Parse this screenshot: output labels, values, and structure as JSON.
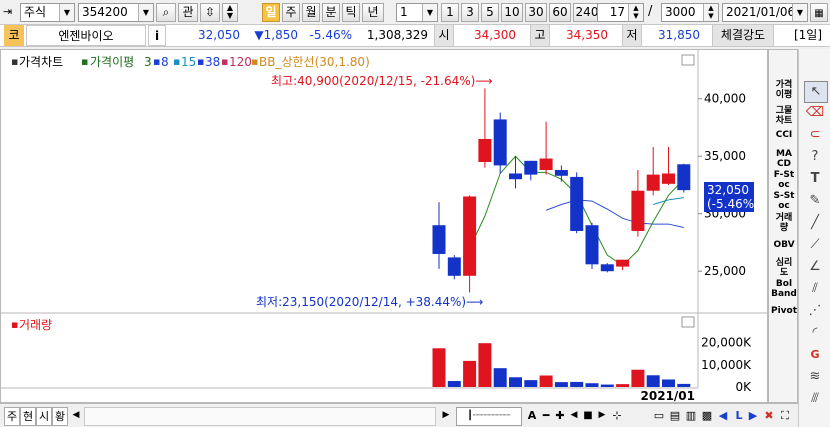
{
  "toolbar": {
    "market_type": "주식",
    "stock_code": "354200",
    "btn_search": "⌕",
    "btn_gwan": "관",
    "period_tabs": [
      "일",
      "주",
      "월",
      "분",
      "틱",
      "년"
    ],
    "active_period": "일",
    "interval_value": "1",
    "interval_presets": [
      "1",
      "3",
      "5",
      "10",
      "30",
      "60",
      "240"
    ],
    "count_value": "17",
    "slash": "/",
    "total_count": "3000",
    "date": "2021/01/06"
  },
  "quote": {
    "market_badge": "코",
    "stock_name": "엔젠바이오",
    "info_btn": "i",
    "price": "32,050",
    "change": "▼1,850",
    "change_pct": "-5.46%",
    "volume": "1,308,329",
    "open_label": "시",
    "open": "34,300",
    "high_label": "고",
    "high": "34,350",
    "low_label": "저",
    "low": "31,850",
    "strength_label": "체결강도",
    "tab_label": "[1일]"
  },
  "legend": {
    "price_chart": "가격차트",
    "ma_label": "가격이평",
    "ma_periods": [
      "3",
      "8",
      "15",
      "38",
      "120"
    ],
    "bb_label": "BB_상한선(30,1.80)",
    "volume_label": "거래량"
  },
  "annotations": {
    "high": "최고:40,900(2020/12/15, -21.64%)⟶",
    "low": "최저:23,150(2020/12/14, +38.44%)⟶"
  },
  "price_badge": {
    "price": "32,050",
    "pct": "(-5.46%)"
  },
  "sidebar_items": [
    "가격이평",
    "그물차트",
    "CCI",
    "MACD",
    "F-Stoc",
    "S-Stoc",
    "거래량",
    "OBV",
    "심리도",
    "Bol Band",
    "Pivot"
  ],
  "bottom": {
    "tabs": [
      "주",
      "현",
      "시",
      "황"
    ],
    "date_label": "2021/01",
    "zoom_a": "A"
  },
  "chart_data": {
    "type": "candlestick",
    "yaxis_price": {
      "ticks": [
        25000,
        30000,
        35000,
        40000
      ],
      "tick_labels": [
        "25,000",
        "30,000",
        "35,000",
        "40,000"
      ],
      "ylim": [
        21800,
        42500
      ]
    },
    "yaxis_volume": {
      "tick_labels": [
        "20,000K",
        "10,000K",
        "0K"
      ],
      "ticks": [
        20000,
        10000,
        0
      ],
      "ylim": [
        0,
        23500
      ]
    },
    "x_label": "2021/01",
    "candles": [
      {
        "open": 29000,
        "close": 26500,
        "high": 31000,
        "low": 25200,
        "dir": "down"
      },
      {
        "open": 26200,
        "close": 24600,
        "high": 26400,
        "low": 24300,
        "dir": "down"
      },
      {
        "open": 24600,
        "close": 31500,
        "high": 31600,
        "low": 23150,
        "dir": "up"
      },
      {
        "open": 34500,
        "close": 36500,
        "high": 40900,
        "low": 34000,
        "dir": "up"
      },
      {
        "open": 38200,
        "close": 34200,
        "high": 38800,
        "low": 33500,
        "dir": "down"
      },
      {
        "open": 33500,
        "close": 33000,
        "high": 35000,
        "low": 32200,
        "dir": "down"
      },
      {
        "open": 34600,
        "close": 33400,
        "high": 34600,
        "low": 32900,
        "dir": "down"
      },
      {
        "open": 33800,
        "close": 34800,
        "high": 38000,
        "low": 33400,
        "dir": "up"
      },
      {
        "open": 33800,
        "close": 33300,
        "high": 34200,
        "low": 32800,
        "dir": "down"
      },
      {
        "open": 33200,
        "close": 28500,
        "high": 33600,
        "low": 28300,
        "dir": "down"
      },
      {
        "open": 29000,
        "close": 25600,
        "high": 29200,
        "low": 25200,
        "dir": "down"
      },
      {
        "open": 25600,
        "close": 25000,
        "high": 25700,
        "low": 24900,
        "dir": "down"
      },
      {
        "open": 25400,
        "close": 26000,
        "high": 26000,
        "low": 25100,
        "dir": "up"
      },
      {
        "open": 28500,
        "close": 32000,
        "high": 33800,
        "low": 28000,
        "dir": "up"
      },
      {
        "open": 32000,
        "close": 33400,
        "high": 35800,
        "low": 31600,
        "dir": "up"
      },
      {
        "open": 32600,
        "close": 33500,
        "high": 35800,
        "low": 32500,
        "dir": "up"
      },
      {
        "open": 34300,
        "close": 32050,
        "high": 34350,
        "low": 31850,
        "dir": "down"
      }
    ],
    "volumes": [
      {
        "value": 17500,
        "dir": "up"
      },
      {
        "value": 2700,
        "dir": "down"
      },
      {
        "value": 11800,
        "dir": "up"
      },
      {
        "value": 19800,
        "dir": "up"
      },
      {
        "value": 8500,
        "dir": "down"
      },
      {
        "value": 4400,
        "dir": "down"
      },
      {
        "value": 3100,
        "dir": "down"
      },
      {
        "value": 5200,
        "dir": "up"
      },
      {
        "value": 2200,
        "dir": "down"
      },
      {
        "value": 2300,
        "dir": "down"
      },
      {
        "value": 1700,
        "dir": "down"
      },
      {
        "value": 1100,
        "dir": "down"
      },
      {
        "value": 1300,
        "dir": "up"
      },
      {
        "value": 7800,
        "dir": "up"
      },
      {
        "value": 5300,
        "dir": "down"
      },
      {
        "value": 3400,
        "dir": "down"
      },
      {
        "value": 1400,
        "dir": "down"
      }
    ],
    "ma_short": [
      null,
      null,
      27000,
      29800,
      33500,
      35000,
      33600,
      33600,
      33000,
      31700,
      29000,
      26400,
      25500,
      26800,
      29300,
      31600,
      33000
    ],
    "ma_long": [
      null,
      null,
      null,
      null,
      null,
      null,
      null,
      30300,
      30800,
      31200,
      31100,
      30400,
      29600,
      29200,
      29100,
      29100,
      28800
    ],
    "ma_mid": [
      null,
      null,
      null,
      null,
      null,
      null,
      null,
      null,
      null,
      null,
      null,
      null,
      null,
      null,
      30800,
      31200,
      31400
    ],
    "colors": {
      "up": "#e0141e",
      "down": "#1232c8",
      "ma_short": "#2a8a1e",
      "ma_long": "#3050d0"
    }
  }
}
